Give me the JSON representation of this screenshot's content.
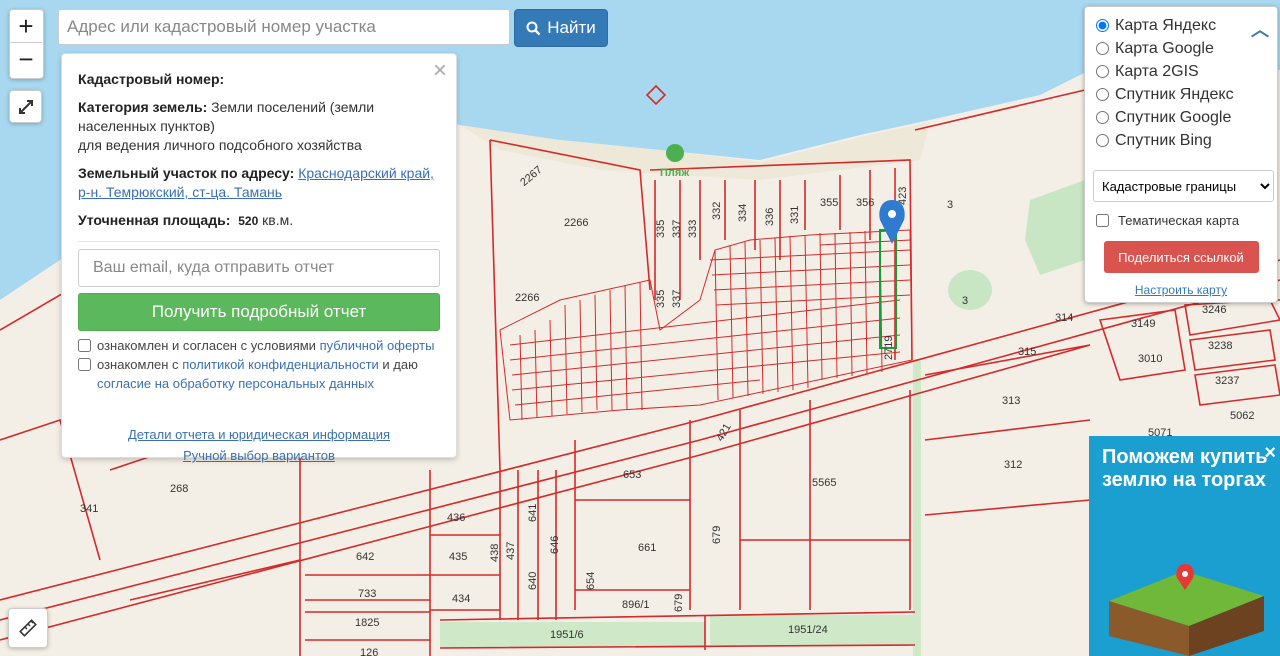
{
  "zoom": {
    "in_label": "+",
    "out_label": "−"
  },
  "search": {
    "placeholder": "Адрес или кадастровый номер участка",
    "button_label": "Найти"
  },
  "info_panel": {
    "cadastral_label": "Кадастровый номер:",
    "category_label": "Категория земель:",
    "category_value": "Земли поселений (земли населенных пунктов)",
    "category_use": "для ведения личного подсобного хозяйства",
    "address_label": "Земельный участок по адресу:",
    "address_value": "Краснодарский край, р-н. Темрюкский, ст-ца. Тамань",
    "area_label": "Уточненная площадь:",
    "area_value": "520",
    "area_unit": "кв.м.",
    "email_placeholder": "Ваш email, куда отправить отчет",
    "report_button": "Получить подробный отчет",
    "consent1_text": "ознакомлен и согласен с условиями",
    "consent1_link": "публичной оферты",
    "consent2_text1": "ознакомлен с",
    "consent2_link1": "политикой конфиденциальности",
    "consent2_text2": "и даю",
    "consent2_link2": "согласие на обработку персональных данных",
    "details_link": "Детали отчета и юридическая информация",
    "manual_link": "Ручной выбор вариантов"
  },
  "layers": {
    "options": [
      "Карта Яндекс",
      "Карта Google",
      "Карта 2GIS",
      "Спутник Яндекс",
      "Спутник Google",
      "Спутник Bing"
    ],
    "selected": "Карта Яндекс",
    "overlay_select": "Кадастровые границы",
    "thematic_label": "Тематическая карта",
    "share_button": "Поделиться ссылкой",
    "setup_link": "Настроить карту"
  },
  "ad": {
    "text": "Поможем купить землю на торгах"
  },
  "map": {
    "beach_label": "Пляж",
    "parcel_labels": [
      "2267",
      "2266",
      "2266",
      "335",
      "337",
      "333",
      "332",
      "334",
      "336",
      "331",
      "355",
      "356",
      "423",
      "3",
      "3",
      "314",
      "315",
      "313",
      "312",
      "3149",
      "3246",
      "3010",
      "3238",
      "3237",
      "5062",
      "5071",
      "2719",
      "421",
      "653",
      "5565",
      "661",
      "679",
      "436",
      "641",
      "435",
      "438",
      "437",
      "646",
      "640",
      "654",
      "434",
      "896/1",
      "679",
      "642",
      "733",
      "1825",
      "1951/6",
      "1951/24",
      "341",
      "268",
      "126",
      "335",
      "337"
    ]
  },
  "colors": {
    "water": "#a8d8f0",
    "land": "#f4efe6",
    "parcel_line": "#d42a2a",
    "green": "#c9e6c4",
    "marker": "#2f7bd2"
  }
}
